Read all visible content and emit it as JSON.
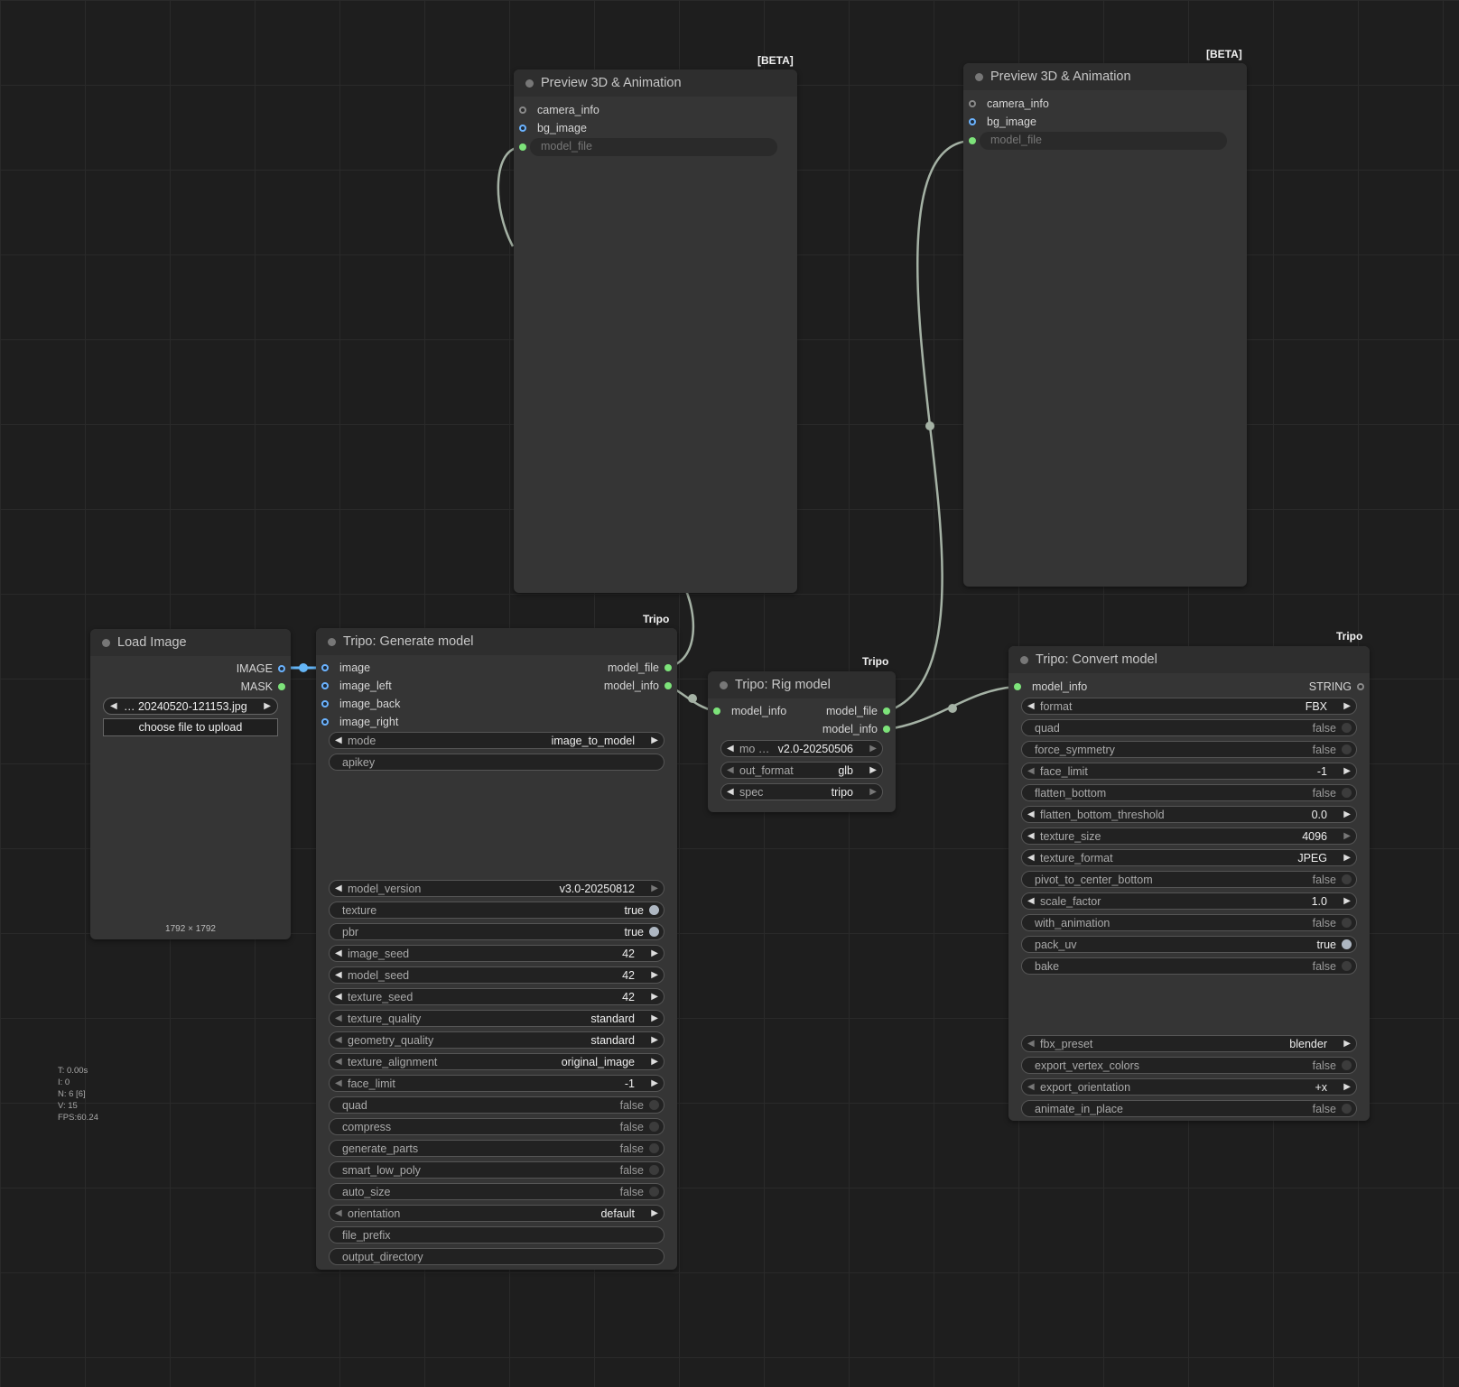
{
  "badges": {
    "beta": "[BETA]",
    "tripo": "Tripo"
  },
  "preview1": {
    "title": "Preview 3D & Animation",
    "inputs": [
      "camera_info",
      "bg_image",
      "model_file"
    ]
  },
  "preview2": {
    "title": "Preview 3D & Animation",
    "inputs": [
      "camera_info",
      "bg_image",
      "model_file"
    ]
  },
  "load_image": {
    "title": "Load Image",
    "outputs": [
      "IMAGE",
      "MASK"
    ],
    "filename": "… 20240520-121153.jpg",
    "upload_label": "choose file to upload",
    "dimensions": "1792 × 1792"
  },
  "generate": {
    "title": "Tripo: Generate model",
    "inputs": [
      "image",
      "image_left",
      "image_back",
      "image_right"
    ],
    "outputs": [
      "model_file",
      "model_info"
    ],
    "mode": {
      "label": "mode",
      "value": "image_to_model"
    },
    "apikey": "apikey",
    "model_version": {
      "label": "model_version",
      "value": "v3.0-20250812"
    },
    "texture": {
      "label": "texture",
      "value": "true"
    },
    "pbr": {
      "label": "pbr",
      "value": "true"
    },
    "image_seed": {
      "label": "image_seed",
      "value": "42"
    },
    "model_seed": {
      "label": "model_seed",
      "value": "42"
    },
    "texture_seed": {
      "label": "texture_seed",
      "value": "42"
    },
    "texture_quality": {
      "label": "texture_quality",
      "value": "standard"
    },
    "geometry_quality": {
      "label": "geometry_quality",
      "value": "standard"
    },
    "texture_alignment": {
      "label": "texture_alignment",
      "value": "original_image"
    },
    "face_limit": {
      "label": "face_limit",
      "value": "-1"
    },
    "quad": {
      "label": "quad",
      "value": "false"
    },
    "compress": {
      "label": "compress",
      "value": "false"
    },
    "generate_parts": {
      "label": "generate_parts",
      "value": "false"
    },
    "smart_low_poly": {
      "label": "smart_low_poly",
      "value": "false"
    },
    "auto_size": {
      "label": "auto_size",
      "value": "false"
    },
    "orientation": {
      "label": "orientation",
      "value": "default"
    },
    "file_prefix": "file_prefix",
    "output_directory": "output_directory"
  },
  "rig": {
    "title": "Tripo: Rig model",
    "inputs": [
      "model_info"
    ],
    "outputs": [
      "model_file",
      "model_info"
    ],
    "model_version": {
      "label": "mo …",
      "value": "v2.0-20250506"
    },
    "out_format": {
      "label": "out_format",
      "value": "glb"
    },
    "spec": {
      "label": "spec",
      "value": "tripo"
    }
  },
  "convert": {
    "title": "Tripo: Convert model",
    "inputs": [
      "model_info"
    ],
    "outputs": [
      "STRING"
    ],
    "format": {
      "label": "format",
      "value": "FBX"
    },
    "quad": {
      "label": "quad",
      "value": "false"
    },
    "force_symmetry": {
      "label": "force_symmetry",
      "value": "false"
    },
    "face_limit": {
      "label": "face_limit",
      "value": "-1"
    },
    "flatten_bottom": {
      "label": "flatten_bottom",
      "value": "false"
    },
    "flatten_bottom_threshold": {
      "label": "flatten_bottom_threshold",
      "value": "0.0"
    },
    "texture_size": {
      "label": "texture_size",
      "value": "4096"
    },
    "texture_format": {
      "label": "texture_format",
      "value": "JPEG"
    },
    "pivot_to_center_bottom": {
      "label": "pivot_to_center_bottom",
      "value": "false"
    },
    "scale_factor": {
      "label": "scale_factor",
      "value": "1.0"
    },
    "with_animation": {
      "label": "with_animation",
      "value": "false"
    },
    "pack_uv": {
      "label": "pack_uv",
      "value": "true"
    },
    "bake": {
      "label": "bake",
      "value": "false"
    },
    "fbx_preset": {
      "label": "fbx_preset",
      "value": "blender"
    },
    "export_vertex_colors": {
      "label": "export_vertex_colors",
      "value": "false"
    },
    "export_orientation": {
      "label": "export_orientation",
      "value": "+x"
    },
    "animate_in_place": {
      "label": "animate_in_place",
      "value": "false"
    }
  },
  "stats": {
    "t": "T: 0.00s",
    "i": "I: 0",
    "n": "N: 6 [6]",
    "v": "V: 15",
    "fps": "FPS:60.24"
  },
  "colors": {
    "link": "#a5b2a5",
    "image_link": "#64b5f6",
    "slot_green": "#7de37a",
    "slot_blue": "#6bb3ff"
  }
}
